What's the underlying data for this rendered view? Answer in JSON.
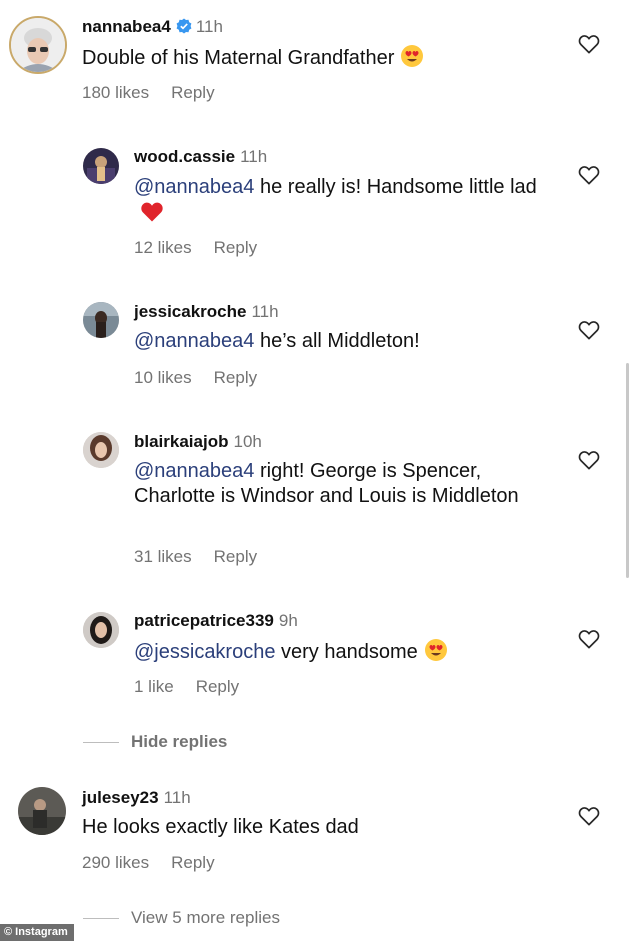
{
  "comments": [
    {
      "username": "nannabea4",
      "verified": true,
      "time": "11h",
      "segments": [
        {
          "text": "Double of his Maternal Grandfather",
          "mention": false
        }
      ],
      "likes": "180 likes",
      "reply": "Reply"
    },
    {
      "username": "wood.cassie",
      "time": "11h",
      "segments": [
        {
          "text": "@nannabea4",
          "mention": true
        },
        {
          "text": " he really is! Handsome little lad",
          "mention": false
        }
      ],
      "likes": "12 likes",
      "reply": "Reply"
    },
    {
      "username": "jessicakroche",
      "time": "11h",
      "segments": [
        {
          "text": "@nannabea4",
          "mention": true
        },
        {
          "text": " he’s all Middleton!",
          "mention": false
        }
      ],
      "likes": "10 likes",
      "reply": "Reply"
    },
    {
      "username": "blairkaiajob",
      "time": "10h",
      "segments": [
        {
          "text": "@nannabea4",
          "mention": true
        },
        {
          "text": " right! George is Spencer, Charlotte is Windsor and Louis is Middleton",
          "mention": false
        }
      ],
      "likes": "31 likes",
      "reply": "Reply"
    },
    {
      "username": "patricepatrice339",
      "time": "9h",
      "segments": [
        {
          "text": "@jessicakroche",
          "mention": true
        },
        {
          "text": " very handsome",
          "mention": false
        }
      ],
      "likes": "1 like",
      "reply": "Reply"
    },
    {
      "username": "julesey23",
      "time": "11h",
      "segments": [
        {
          "text": "He looks exactly like Kates dad",
          "mention": false
        }
      ],
      "likes": "290 likes",
      "reply": "Reply"
    }
  ],
  "hide_replies": "Hide replies",
  "view_more": "View 5 more replies",
  "watermark": "© Instagram",
  "icons": {
    "heart": "heart-outline-icon",
    "verified": "verified-badge-icon",
    "emoji_heart_eyes": "heart-eyes-emoji",
    "emoji_red_heart": "red-heart-emoji"
  },
  "colors": {
    "mention": "#2b3f7a",
    "meta": "#737373",
    "verified": "#3897f0",
    "heart_emoji": "#e0242b"
  }
}
